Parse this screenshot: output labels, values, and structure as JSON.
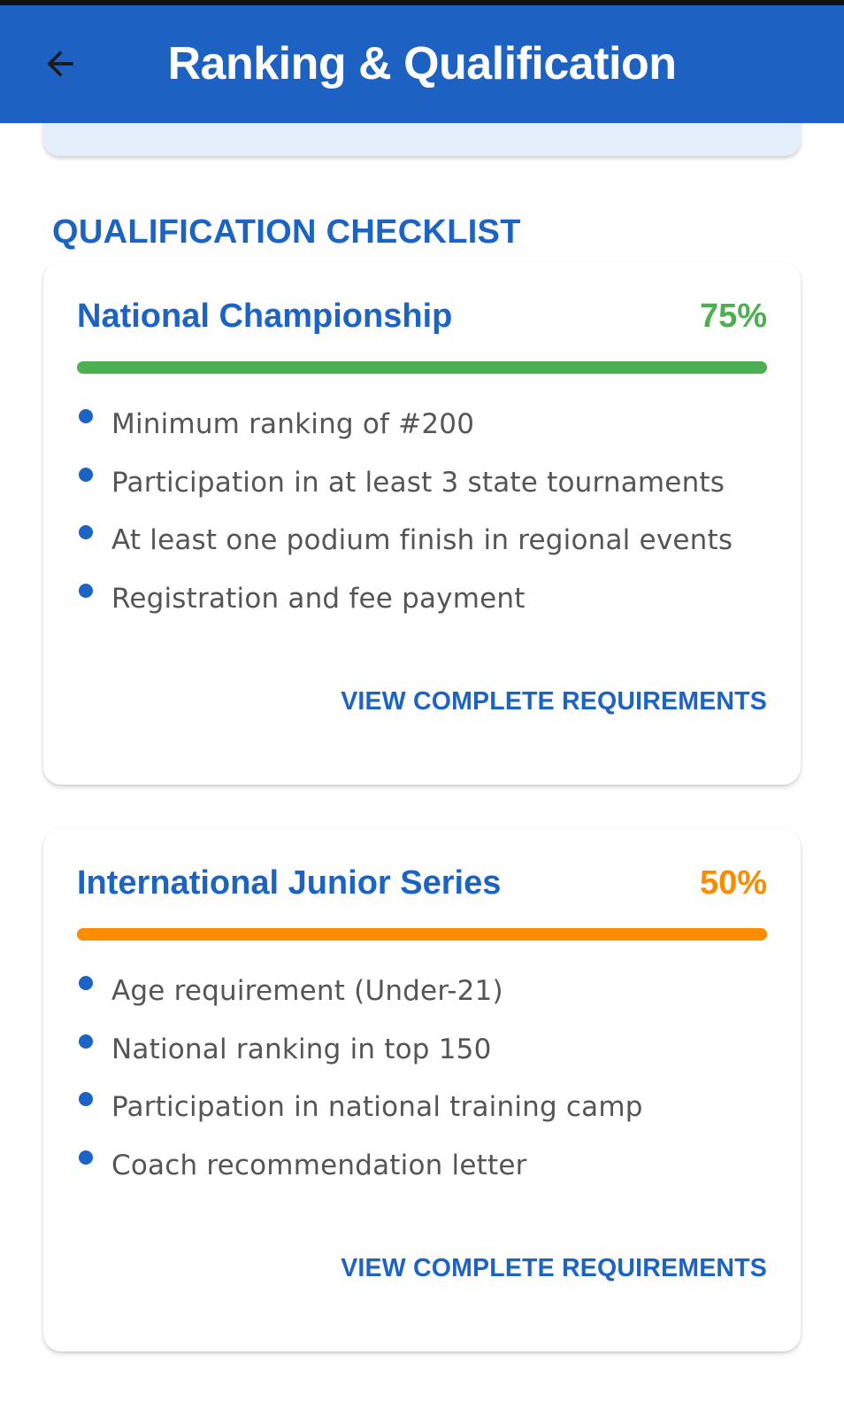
{
  "app_bar": {
    "title": "Ranking & Qualification",
    "back_icon": "arrow-left-icon",
    "background_color": "#1d62c2"
  },
  "section": {
    "header": "QUALIFICATION CHECKLIST"
  },
  "cards": [
    {
      "title": "National Championship",
      "percent_label": "75%",
      "progress": 0.75,
      "accent_color": "#4caf50",
      "requirements": [
        "Minimum ranking of #200",
        "Participation in at least 3 state tournaments",
        "At least one podium finish in regional events",
        "Registration and fee payment"
      ],
      "action_label": "VIEW COMPLETE REQUIREMENTS"
    },
    {
      "title": "International Junior Series",
      "percent_label": "50%",
      "progress": 0.5,
      "accent_color": "#fb8c00",
      "requirements": [
        "Age requirement (Under-21)",
        "National ranking in top 150",
        "Participation in national training camp",
        "Coach recommendation letter"
      ],
      "action_label": "VIEW COMPLETE REQUIREMENTS"
    }
  ]
}
